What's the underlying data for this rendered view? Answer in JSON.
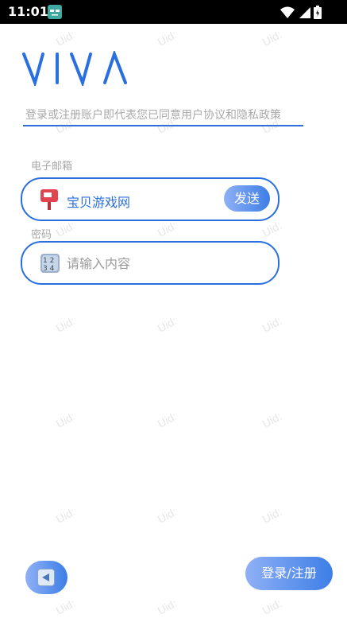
{
  "status_bar": {
    "time": "11:01"
  },
  "brand": {
    "logo_text": "VIVA",
    "color": "#2a6fe0"
  },
  "agreement": {
    "text": "登录或注册账户即代表您已同意用户协议和隐私政策"
  },
  "email": {
    "label": "电子邮箱",
    "value": "宝贝游戏网",
    "send_label": "发送"
  },
  "password": {
    "label": "密码",
    "placeholder": "请输入内容"
  },
  "actions": {
    "login_register_label": "登录/注册"
  },
  "watermark": {
    "text": "Uid:"
  },
  "colors": {
    "accent": "#2a6fe0",
    "gradient_start": "#8fb0f6",
    "gradient_end": "#3d7ee6"
  }
}
